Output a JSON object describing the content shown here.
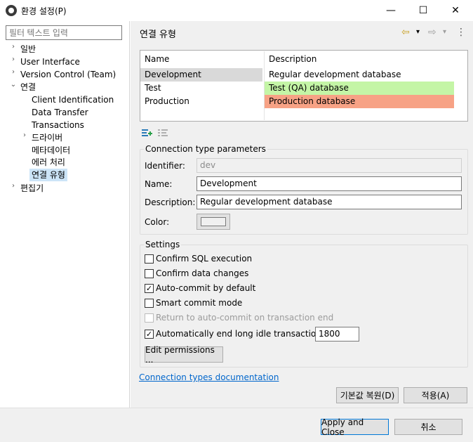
{
  "window": {
    "title": "환경 설정(P)",
    "minimize": "—",
    "maximize": "☐",
    "close": "✕"
  },
  "sidebar": {
    "filter_placeholder": "필터 텍스트 입력",
    "items": [
      {
        "label": "일반",
        "expand": "›"
      },
      {
        "label": "User Interface",
        "expand": "›"
      },
      {
        "label": "Version Control (Team)",
        "expand": "›"
      },
      {
        "label": "연결",
        "expand": "⌄"
      },
      {
        "label": "Client Identification"
      },
      {
        "label": "Data Transfer"
      },
      {
        "label": "Transactions"
      },
      {
        "label": "드라이버",
        "expand": "›"
      },
      {
        "label": "메타데이터"
      },
      {
        "label": "에러 처리"
      },
      {
        "label": "연결 유형"
      },
      {
        "label": "편집기",
        "expand": "›"
      }
    ]
  },
  "main": {
    "title": "연결 유형",
    "nav": {
      "back": "⇦",
      "back_menu": "▾",
      "forward": "⇨",
      "forward_menu": "▾",
      "more": "⋮"
    },
    "table": {
      "columns": [
        "Name",
        "Description"
      ],
      "rows": [
        {
          "name": "Development",
          "description": "Regular development database",
          "color": "#ffffff"
        },
        {
          "name": "Test",
          "description": "Test (QA) database",
          "color": "#c4f5a6"
        },
        {
          "name": "Production",
          "description": "Production database",
          "color": "#f7a285"
        }
      ]
    },
    "params": {
      "group_label": "Connection type parameters",
      "identifier_label": "Identifier:",
      "identifier_value": "dev",
      "name_label": "Name:",
      "name_value": "Development",
      "description_label": "Description:",
      "description_value": "Regular development database",
      "color_label": "Color:"
    },
    "settings": {
      "group_label": "Settings",
      "checks": [
        {
          "label": "Confirm SQL execution",
          "checked": ""
        },
        {
          "label": "Confirm data changes",
          "checked": ""
        },
        {
          "label": "Auto-commit by default",
          "checked": "✓"
        },
        {
          "label": "Smart commit mode",
          "checked": ""
        },
        {
          "label": "Return to auto-commit on transaction end",
          "checked": ""
        },
        {
          "label": "Automatically end long idle transactions",
          "checked": "✓"
        }
      ],
      "idle_value": "1800",
      "edit_permissions": "Edit permissions ..."
    },
    "doc_link": "Connection types documentation",
    "restore_defaults": "기본값 복원(D)",
    "apply": "적용(A)"
  },
  "footer": {
    "apply_close": "Apply and Close",
    "cancel": "취소"
  },
  "colors": {
    "selection": "#cce4f7",
    "test_row": "#c4f5a6",
    "production_row": "#f7a285",
    "link": "#0066cc",
    "panel_bg": "#f0f0f0"
  }
}
